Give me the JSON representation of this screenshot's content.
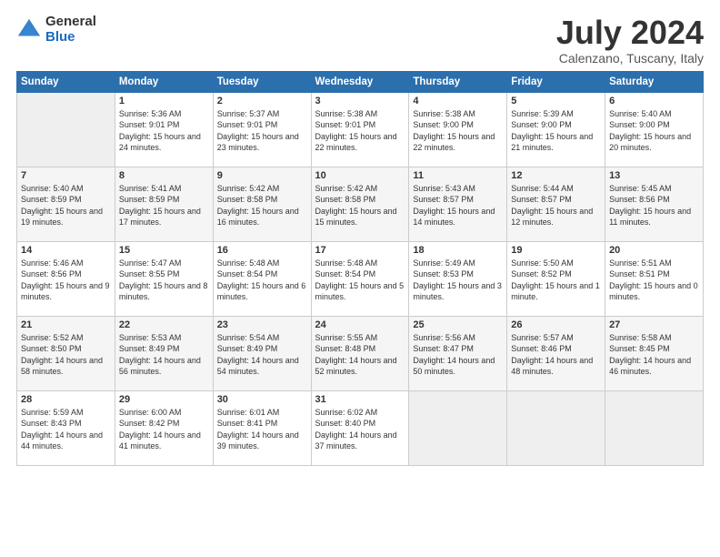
{
  "header": {
    "logo_general": "General",
    "logo_blue": "Blue",
    "month_title": "July 2024",
    "location": "Calenzano, Tuscany, Italy"
  },
  "days_of_week": [
    "Sunday",
    "Monday",
    "Tuesday",
    "Wednesday",
    "Thursday",
    "Friday",
    "Saturday"
  ],
  "weeks": [
    [
      {
        "day": "",
        "empty": true
      },
      {
        "day": "1",
        "sunrise": "Sunrise: 5:36 AM",
        "sunset": "Sunset: 9:01 PM",
        "daylight": "Daylight: 15 hours and 24 minutes."
      },
      {
        "day": "2",
        "sunrise": "Sunrise: 5:37 AM",
        "sunset": "Sunset: 9:01 PM",
        "daylight": "Daylight: 15 hours and 23 minutes."
      },
      {
        "day": "3",
        "sunrise": "Sunrise: 5:38 AM",
        "sunset": "Sunset: 9:01 PM",
        "daylight": "Daylight: 15 hours and 22 minutes."
      },
      {
        "day": "4",
        "sunrise": "Sunrise: 5:38 AM",
        "sunset": "Sunset: 9:00 PM",
        "daylight": "Daylight: 15 hours and 22 minutes."
      },
      {
        "day": "5",
        "sunrise": "Sunrise: 5:39 AM",
        "sunset": "Sunset: 9:00 PM",
        "daylight": "Daylight: 15 hours and 21 minutes."
      },
      {
        "day": "6",
        "sunrise": "Sunrise: 5:40 AM",
        "sunset": "Sunset: 9:00 PM",
        "daylight": "Daylight: 15 hours and 20 minutes."
      }
    ],
    [
      {
        "day": "7",
        "sunrise": "Sunrise: 5:40 AM",
        "sunset": "Sunset: 8:59 PM",
        "daylight": "Daylight: 15 hours and 19 minutes."
      },
      {
        "day": "8",
        "sunrise": "Sunrise: 5:41 AM",
        "sunset": "Sunset: 8:59 PM",
        "daylight": "Daylight: 15 hours and 17 minutes."
      },
      {
        "day": "9",
        "sunrise": "Sunrise: 5:42 AM",
        "sunset": "Sunset: 8:58 PM",
        "daylight": "Daylight: 15 hours and 16 minutes."
      },
      {
        "day": "10",
        "sunrise": "Sunrise: 5:42 AM",
        "sunset": "Sunset: 8:58 PM",
        "daylight": "Daylight: 15 hours and 15 minutes."
      },
      {
        "day": "11",
        "sunrise": "Sunrise: 5:43 AM",
        "sunset": "Sunset: 8:57 PM",
        "daylight": "Daylight: 15 hours and 14 minutes."
      },
      {
        "day": "12",
        "sunrise": "Sunrise: 5:44 AM",
        "sunset": "Sunset: 8:57 PM",
        "daylight": "Daylight: 15 hours and 12 minutes."
      },
      {
        "day": "13",
        "sunrise": "Sunrise: 5:45 AM",
        "sunset": "Sunset: 8:56 PM",
        "daylight": "Daylight: 15 hours and 11 minutes."
      }
    ],
    [
      {
        "day": "14",
        "sunrise": "Sunrise: 5:46 AM",
        "sunset": "Sunset: 8:56 PM",
        "daylight": "Daylight: 15 hours and 9 minutes."
      },
      {
        "day": "15",
        "sunrise": "Sunrise: 5:47 AM",
        "sunset": "Sunset: 8:55 PM",
        "daylight": "Daylight: 15 hours and 8 minutes."
      },
      {
        "day": "16",
        "sunrise": "Sunrise: 5:48 AM",
        "sunset": "Sunset: 8:54 PM",
        "daylight": "Daylight: 15 hours and 6 minutes."
      },
      {
        "day": "17",
        "sunrise": "Sunrise: 5:48 AM",
        "sunset": "Sunset: 8:54 PM",
        "daylight": "Daylight: 15 hours and 5 minutes."
      },
      {
        "day": "18",
        "sunrise": "Sunrise: 5:49 AM",
        "sunset": "Sunset: 8:53 PM",
        "daylight": "Daylight: 15 hours and 3 minutes."
      },
      {
        "day": "19",
        "sunrise": "Sunrise: 5:50 AM",
        "sunset": "Sunset: 8:52 PM",
        "daylight": "Daylight: 15 hours and 1 minute."
      },
      {
        "day": "20",
        "sunrise": "Sunrise: 5:51 AM",
        "sunset": "Sunset: 8:51 PM",
        "daylight": "Daylight: 15 hours and 0 minutes."
      }
    ],
    [
      {
        "day": "21",
        "sunrise": "Sunrise: 5:52 AM",
        "sunset": "Sunset: 8:50 PM",
        "daylight": "Daylight: 14 hours and 58 minutes."
      },
      {
        "day": "22",
        "sunrise": "Sunrise: 5:53 AM",
        "sunset": "Sunset: 8:49 PM",
        "daylight": "Daylight: 14 hours and 56 minutes."
      },
      {
        "day": "23",
        "sunrise": "Sunrise: 5:54 AM",
        "sunset": "Sunset: 8:49 PM",
        "daylight": "Daylight: 14 hours and 54 minutes."
      },
      {
        "day": "24",
        "sunrise": "Sunrise: 5:55 AM",
        "sunset": "Sunset: 8:48 PM",
        "daylight": "Daylight: 14 hours and 52 minutes."
      },
      {
        "day": "25",
        "sunrise": "Sunrise: 5:56 AM",
        "sunset": "Sunset: 8:47 PM",
        "daylight": "Daylight: 14 hours and 50 minutes."
      },
      {
        "day": "26",
        "sunrise": "Sunrise: 5:57 AM",
        "sunset": "Sunset: 8:46 PM",
        "daylight": "Daylight: 14 hours and 48 minutes."
      },
      {
        "day": "27",
        "sunrise": "Sunrise: 5:58 AM",
        "sunset": "Sunset: 8:45 PM",
        "daylight": "Daylight: 14 hours and 46 minutes."
      }
    ],
    [
      {
        "day": "28",
        "sunrise": "Sunrise: 5:59 AM",
        "sunset": "Sunset: 8:43 PM",
        "daylight": "Daylight: 14 hours and 44 minutes."
      },
      {
        "day": "29",
        "sunrise": "Sunrise: 6:00 AM",
        "sunset": "Sunset: 8:42 PM",
        "daylight": "Daylight: 14 hours and 41 minutes."
      },
      {
        "day": "30",
        "sunrise": "Sunrise: 6:01 AM",
        "sunset": "Sunset: 8:41 PM",
        "daylight": "Daylight: 14 hours and 39 minutes."
      },
      {
        "day": "31",
        "sunrise": "Sunrise: 6:02 AM",
        "sunset": "Sunset: 8:40 PM",
        "daylight": "Daylight: 14 hours and 37 minutes."
      },
      {
        "day": "",
        "empty": true
      },
      {
        "day": "",
        "empty": true
      },
      {
        "day": "",
        "empty": true
      }
    ]
  ]
}
